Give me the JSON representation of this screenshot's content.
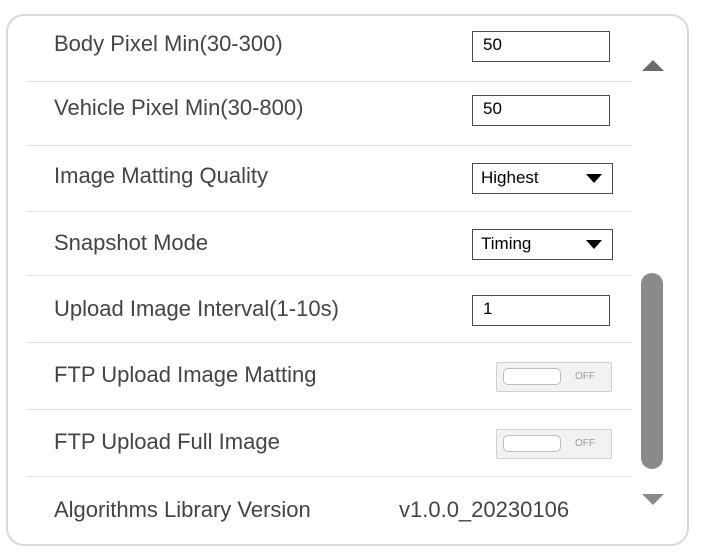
{
  "settings": {
    "body_pixel_min": {
      "label": "Body Pixel Min(30-300)",
      "value": "50"
    },
    "vehicle_pixel_min": {
      "label": "Vehicle Pixel Min(30-800)",
      "value": "50"
    },
    "image_matting_quality": {
      "label": "Image Matting Quality",
      "value": "Highest"
    },
    "snapshot_mode": {
      "label": "Snapshot Mode",
      "value": "Timing"
    },
    "upload_image_interval": {
      "label": "Upload Image Interval(1-10s)",
      "value": "1"
    },
    "ftp_upload_image_matting": {
      "label": "FTP Upload Image Matting",
      "state": "OFF"
    },
    "ftp_upload_full_image": {
      "label": "FTP Upload Full Image",
      "state": "OFF"
    },
    "algorithms_library_version": {
      "label": "Algorithms Library Version",
      "value": "v1.0.0_20230106"
    }
  },
  "icons": {
    "scroll_up": "triangle-up-icon",
    "scroll_down": "triangle-down-icon",
    "dropdown": "caret-down-icon"
  },
  "colors": {
    "label_text": "#444444",
    "scrollbar": "#8a8a8a",
    "toggle_off_bg": "#f2f2f2"
  }
}
